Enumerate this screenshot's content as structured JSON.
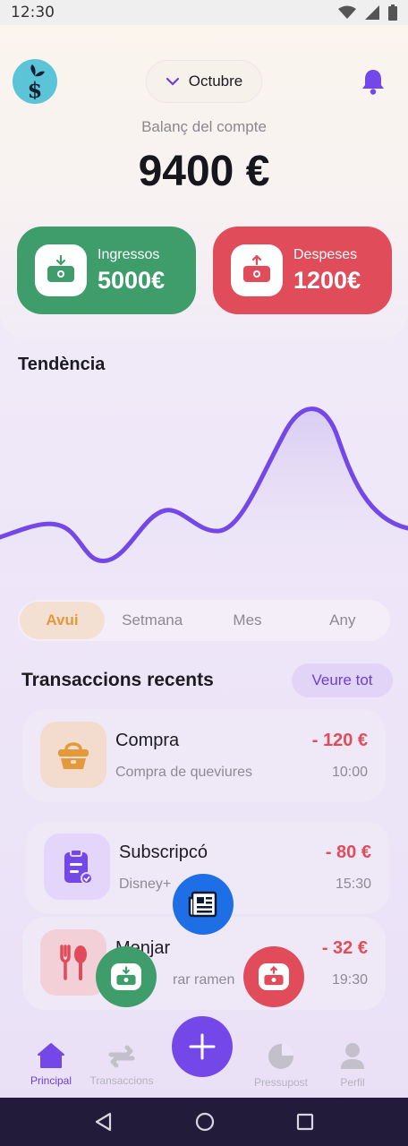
{
  "status_bar": {
    "time": "12:30",
    "icons": [
      "wifi-icon",
      "signal-icon",
      "battery-icon"
    ]
  },
  "header": {
    "month": "Octubre",
    "balance_label": "Balanç del compte",
    "balance_value": "9400 €"
  },
  "income": {
    "label": "Ingressos",
    "value": "5000€",
    "color": "#3f9d6c"
  },
  "expense": {
    "label": "Despeses",
    "value": "1200€",
    "color": "#e04c5a"
  },
  "trend": {
    "title": "Tendència",
    "line_color": "#7448e8"
  },
  "period_tabs": [
    {
      "label": "Avui",
      "active": true
    },
    {
      "label": "Setmana",
      "active": false
    },
    {
      "label": "Mes",
      "active": false
    },
    {
      "label": "Any",
      "active": false
    }
  ],
  "recent": {
    "title": "Transaccions recents",
    "see_all": "Veure tot",
    "items": [
      {
        "title": "Compra",
        "desc": "Compra de queviures",
        "amount": "- 120 €",
        "time": "10:00",
        "icon": "basket-icon"
      },
      {
        "title": "Subscripcó",
        "desc": "Disney+",
        "amount": "- 80 €",
        "time": "15:30",
        "icon": "clipboard-icon"
      },
      {
        "title": "Menjar",
        "desc": "rar ramen",
        "amount": "- 32 €",
        "time": "19:30",
        "icon": "cutlery-icon"
      }
    ]
  },
  "nav": [
    {
      "label": "Principal",
      "icon": "home-icon",
      "active": true
    },
    {
      "label": "Transaccions",
      "icon": "transfer-icon",
      "active": false
    },
    {
      "label": "Pressupost",
      "icon": "pie-chart-icon",
      "active": false
    },
    {
      "label": "Perfil",
      "icon": "user-icon",
      "active": false
    }
  ],
  "accent": "#7448e8"
}
